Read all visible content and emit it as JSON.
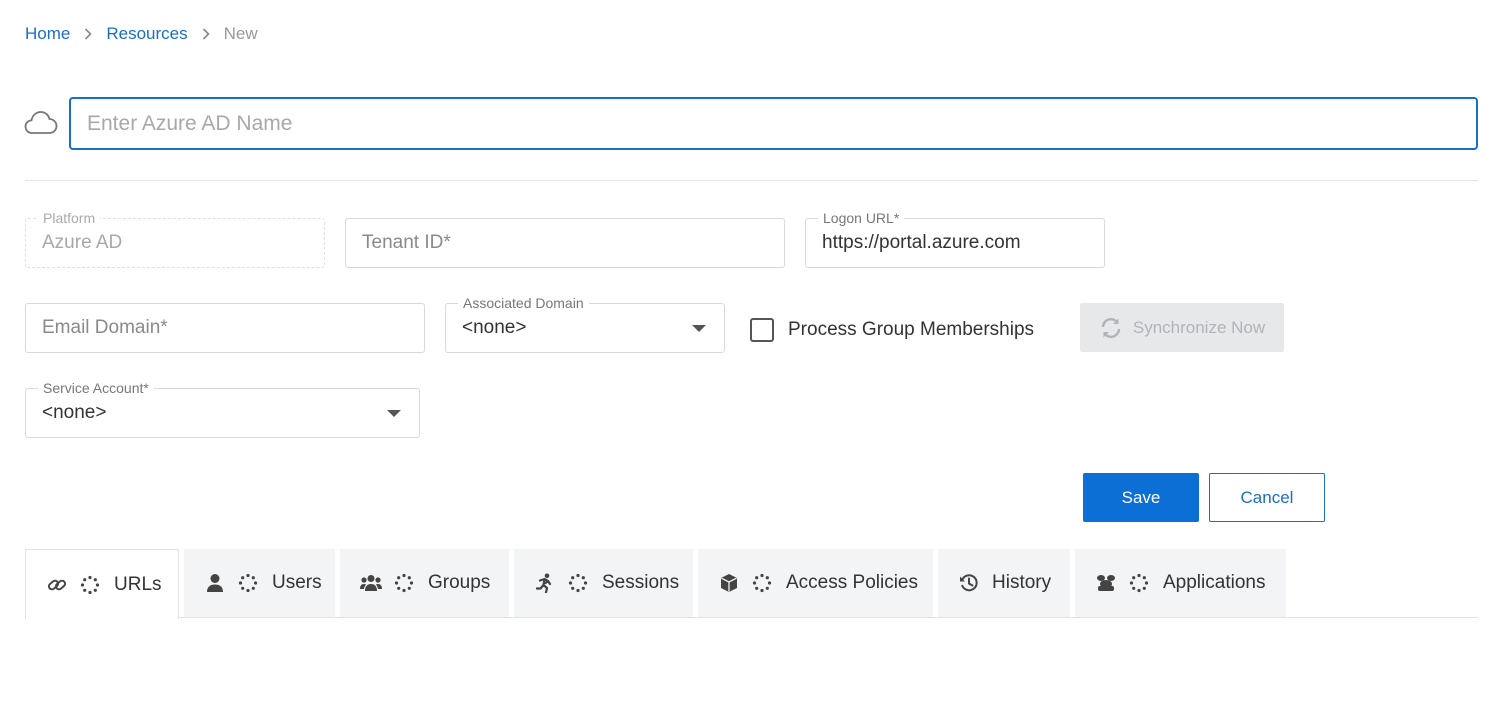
{
  "breadcrumb": {
    "items": [
      "Home",
      "Resources"
    ],
    "current": "New"
  },
  "name_field": {
    "icon": "cloud-icon",
    "placeholder": "Enter Azure AD Name",
    "value": ""
  },
  "platform": {
    "label": "Platform",
    "value": "Azure AD"
  },
  "tenant_id": {
    "placeholder": "Tenant ID*",
    "value": ""
  },
  "logon_url": {
    "label": "Logon URL*",
    "value": "https://portal.azure.com"
  },
  "email_domain": {
    "placeholder": "Email Domain*",
    "value": ""
  },
  "associated_domain": {
    "label": "Associated Domain",
    "value": "<none>"
  },
  "process_group": {
    "label": "Process Group Memberships",
    "checked": false
  },
  "sync_button": {
    "label": "Synchronize Now",
    "icon": "sync-icon"
  },
  "service_account": {
    "label": "Service Account*",
    "value": "<none>"
  },
  "actions": {
    "save": "Save",
    "cancel": "Cancel"
  },
  "tabs": [
    {
      "label": "URLs",
      "icon": "link-icon",
      "active": true
    },
    {
      "label": "Users",
      "icon": "user-icon",
      "active": false
    },
    {
      "label": "Groups",
      "icon": "users-icon",
      "active": false
    },
    {
      "label": "Sessions",
      "icon": "running-icon",
      "active": false
    },
    {
      "label": "Access Policies",
      "icon": "cube-icon",
      "active": false
    },
    {
      "label": "History",
      "icon": "history-icon",
      "active": false
    },
    {
      "label": "Applications",
      "icon": "applications-icon",
      "active": false
    }
  ],
  "colors": {
    "primary": "#0b6fd6",
    "link": "#1a6fc4",
    "disabled_bg": "#e6e8ea",
    "tab_bg": "#f3f4f5"
  }
}
